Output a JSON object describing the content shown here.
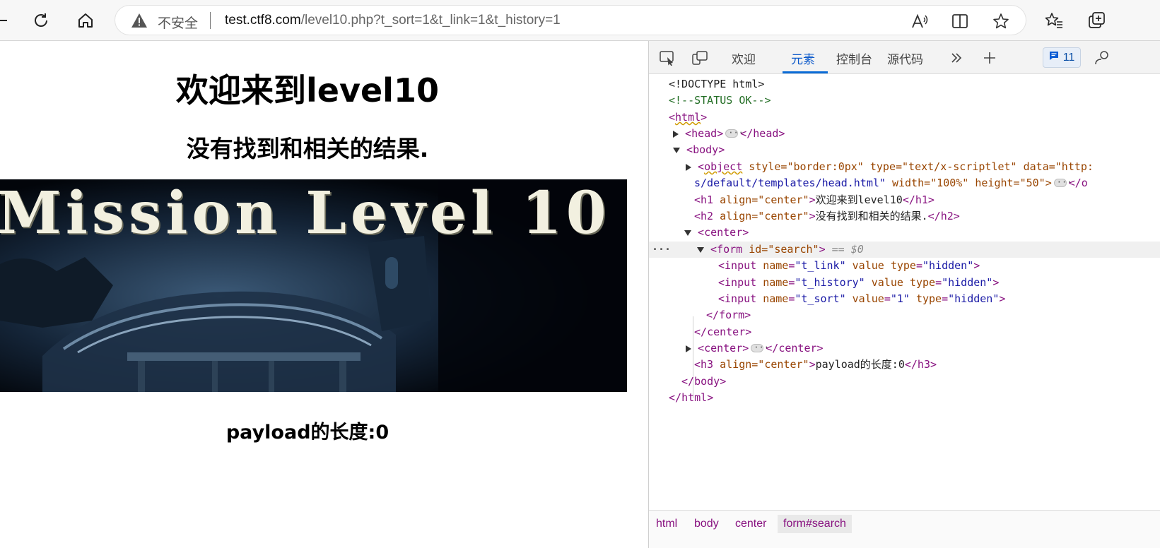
{
  "browser": {
    "security_label": "不安全",
    "url_host": "test.ctf8.com",
    "url_path": "/level10.php?t_sort=1&t_link=1&t_history=1"
  },
  "page": {
    "h1": "欢迎来到level10",
    "h2": "没有找到和相关的结果.",
    "banner_text": "Mission Level 10",
    "h3": "payload的长度:0"
  },
  "devtools": {
    "tabs": [
      "欢迎",
      "元素",
      "控制台",
      "源代码"
    ],
    "active_tab": "元素",
    "issues_count": "11",
    "code": {
      "doctype": "<!DOCTYPE html>",
      "comment": "<!--STATUS OK-->",
      "html_open": "html",
      "head": "head",
      "body": "body",
      "object_tag": "object",
      "object_attrs1": "style=\"border:0px\" type=\"text/x-scriptlet\" data=\"http:",
      "object_line2_a": "s/default/templates/head.html\"",
      "object_line2_b": "width=\"100%\" height=\"50\">",
      "h1_attr": "align=\"center\"",
      "h1_text": "欢迎来到level10",
      "h2_text": "没有找到和相关的结果.",
      "center": "center",
      "form_attr": "id=\"search\"",
      "form_marker": "== $0",
      "input1_name": "\"t_link\"",
      "input2_name": "\"t_history\"",
      "input3_name": "\"t_sort\"",
      "input3_value": "\"1\"",
      "hidden": "\"hidden\"",
      "h3_text": "payload的长度:0"
    },
    "breadcrumbs": [
      "html",
      "body",
      "center",
      "form#search"
    ]
  }
}
